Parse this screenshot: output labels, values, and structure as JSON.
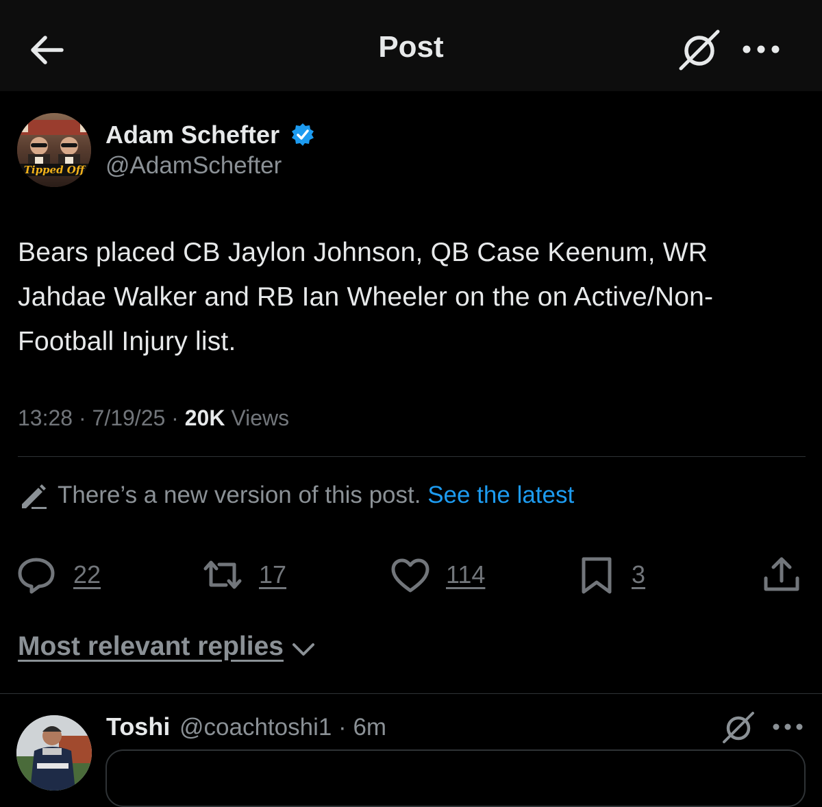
{
  "header": {
    "title": "Post",
    "back_icon": "arrow-left-icon",
    "grok_icon": "grok-icon",
    "more_icon": "more-horizontal-icon"
  },
  "post": {
    "author_name": "Adam Schefter",
    "author_handle": "@AdamSchefter",
    "verified": true,
    "avatar_caption": "Tipped Off",
    "text": "Bears placed CB Jaylon Johnson, QB Case Keenum, WR Jahdae Walker and RB Ian Wheeler on the on Active/Non-Football Injury list.",
    "time": "13:28",
    "date": "7/19/25",
    "separator": " · ",
    "views_count": "20K",
    "views_label": " Views"
  },
  "edit_notice": {
    "text": "There’s a new version of this post. ",
    "link": "See the latest"
  },
  "actions": {
    "replies": "22",
    "reposts": "17",
    "likes": "114",
    "bookmarks": "3"
  },
  "replies_sort": {
    "label": "Most relevant replies"
  },
  "reply": {
    "name": "Toshi",
    "handle": "@coachtoshi1",
    "time": "6m",
    "separator": " · "
  },
  "colors": {
    "background": "#000000",
    "header_bg": "#0d0d0d",
    "primary_text": "#e7e9ea",
    "secondary_text": "#8b9196",
    "accent": "#1d9bf0",
    "divider": "#2f3336"
  }
}
